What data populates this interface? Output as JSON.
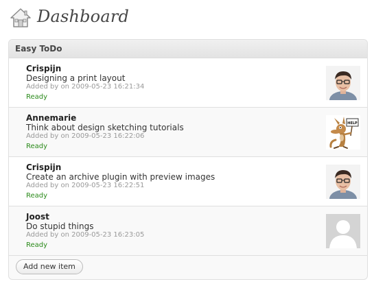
{
  "page": {
    "title": "Dashboard",
    "icon": "home-icon"
  },
  "widget": {
    "title": "Easy ToDo",
    "items": [
      {
        "name": "Crispijn",
        "task": "Designing a print layout",
        "meta": "Added by on 2009-05-23 16:21:34",
        "status": "Ready",
        "avatar": "person-photo"
      },
      {
        "name": "Annemarie",
        "task": "Think about design sketching tutorials",
        "meta": "Added by on 2009-05-23 16:22:06",
        "status": "Ready",
        "avatar": "cartoon-coyote-help-sign"
      },
      {
        "name": "Crispijn",
        "task": "Create an archive plugin with preview images",
        "meta": "Added by on 2009-05-23 16:22:51",
        "status": "Ready",
        "avatar": "person-photo"
      },
      {
        "name": "Joost",
        "task": "Do stupid things",
        "meta": "Added by on 2009-05-23 16:23:05",
        "status": "Ready",
        "avatar": "default-avatar"
      }
    ],
    "add_button_label": "Add new item"
  },
  "colors": {
    "status_ready": "#2a8a1a",
    "title_text": "#464646",
    "meta_text": "#999999"
  }
}
